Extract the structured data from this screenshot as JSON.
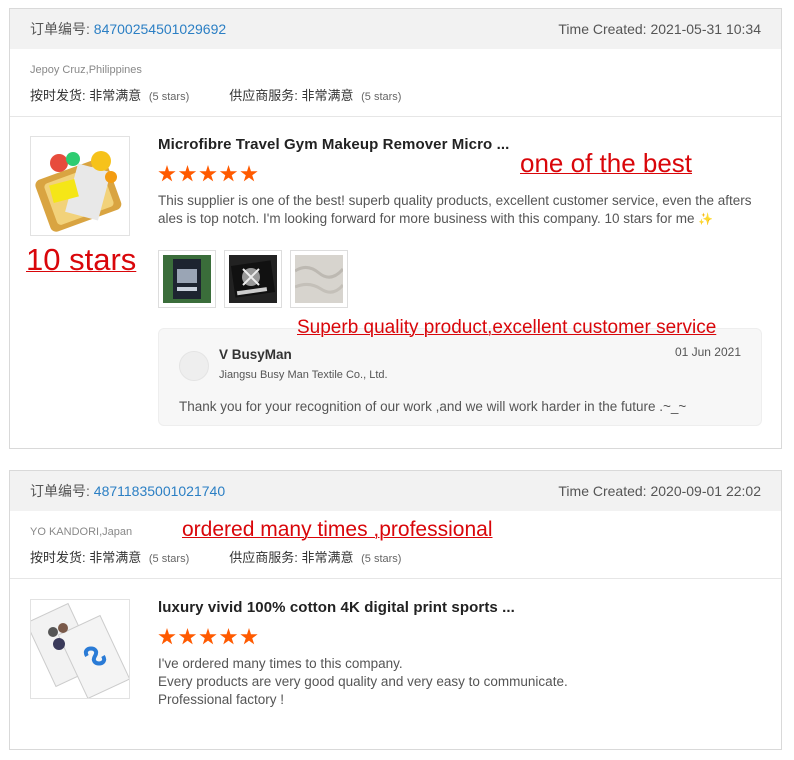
{
  "orders": [
    {
      "order_label": "订单编号:",
      "order_id": "84700254501029692",
      "time_created": "Time Created: 2021-05-31 10:34",
      "buyer": "Jepoy Cruz,Philippines",
      "ratings": [
        {
          "label": "按时发货:",
          "value": "非常满意",
          "stars": "(5 stars)"
        },
        {
          "label": "供应商服务:",
          "value": "非常满意",
          "stars": "(5 stars)"
        }
      ],
      "product_title": "Microfibre Travel Gym Makeup Remover Micro ...",
      "star_rating": 5,
      "review_lines": [
        "This supplier is one of the best! superb quality products, excellent customer service, even the afters",
        "ales is top notch. I'm looking forward for more business with this company. 10 stars for me"
      ],
      "sparkle_icon": "sparkles-icon",
      "reply": {
        "name": "V BusyMan",
        "company": "Jiangsu Busy Man Textile Co., Ltd.",
        "date": "01 Jun 2021",
        "text": "Thank you for your recognition of our work ,and we will work harder in the future .~_~"
      }
    },
    {
      "order_label": "订单编号:",
      "order_id": "48711835001021740",
      "time_created": "Time Created: 2020-09-01 22:02",
      "buyer": "YO KANDORI,Japan",
      "ratings": [
        {
          "label": "按时发货:",
          "value": "非常满意",
          "stars": "(5 stars)"
        },
        {
          "label": "供应商服务:",
          "value": "非常满意",
          "stars": "(5 stars)"
        }
      ],
      "product_title": "luxury vivid 100% cotton 4K digital print sports ...",
      "star_rating": 5,
      "review_lines": [
        "I've ordered many times to this company.",
        "Every products are very good quality and very easy to communicate.",
        "Professional factory !"
      ]
    }
  ],
  "annotations": {
    "one_of_best": "one of the best",
    "ten_stars": "10 stars",
    "superb": "Superb quality product,excellent customer service",
    "ordered_many": "ordered many times ,professional"
  },
  "colors": {
    "accent_link": "#2b7fc4",
    "star": "#ff5a00",
    "annotation_red": "#d9060a",
    "header_bg": "#f2f2f2"
  }
}
